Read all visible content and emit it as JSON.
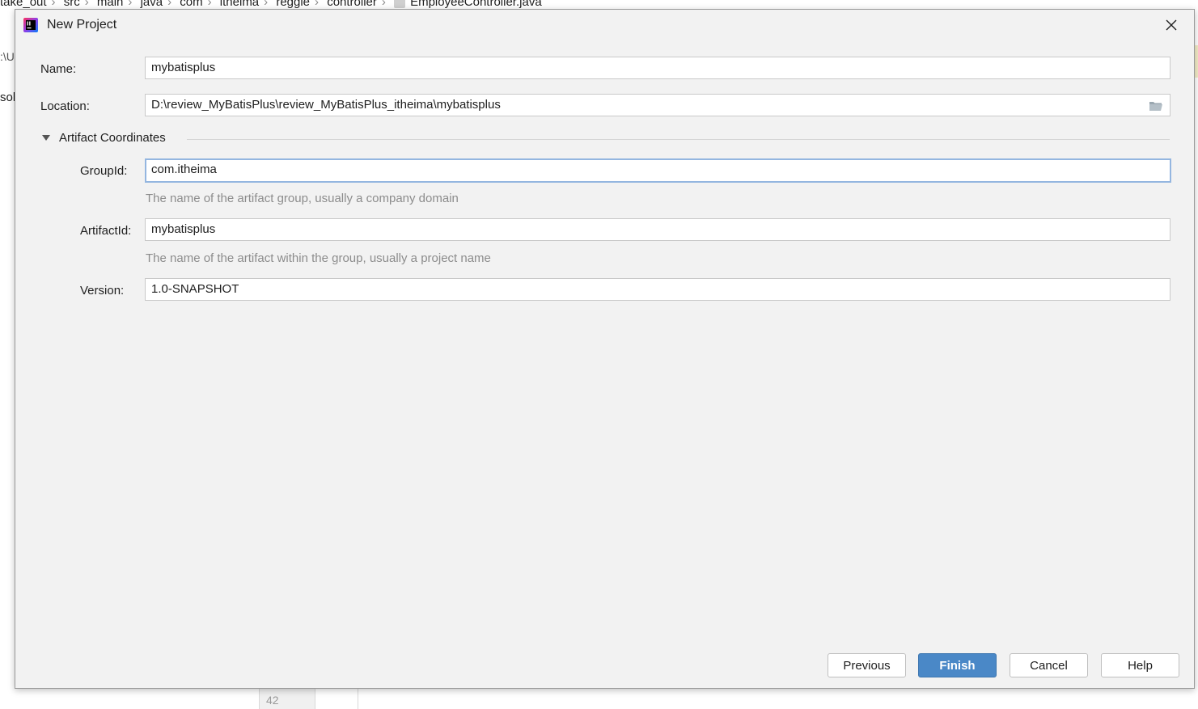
{
  "background": {
    "breadcrumb": [
      "take_out",
      "src",
      "main",
      "java",
      "com",
      "itheima",
      "reggie",
      "controller",
      "EmployeeController.java"
    ],
    "left_fragment_1": ":\\U",
    "left_fragment_2": "sol",
    "line_number": "42"
  },
  "dialog": {
    "title": "New Project",
    "icon": "intellij-app-icon",
    "name": {
      "label": "Name:",
      "value": "mybatisplus"
    },
    "location": {
      "label": "Location:",
      "value": "D:\\review_MyBatisPlus\\review_MyBatisPlus_itheima\\mybatisplus"
    },
    "artifact_section": {
      "title": "Artifact Coordinates",
      "groupid": {
        "label": "GroupId:",
        "value": "com.itheima",
        "hint": "The name of the artifact group, usually a company domain"
      },
      "artifactid": {
        "label": "ArtifactId:",
        "value": "mybatisplus",
        "hint": "The name of the artifact within the group, usually a project name"
      },
      "version": {
        "label": "Version:",
        "value": "1.0-SNAPSHOT"
      }
    },
    "buttons": {
      "previous": "Previous",
      "finish": "Finish",
      "cancel": "Cancel",
      "help": "Help"
    }
  },
  "colors": {
    "primary_button": "#4a88c7",
    "focus_border": "#94b6e0",
    "dialog_bg": "#f2f2f2"
  }
}
